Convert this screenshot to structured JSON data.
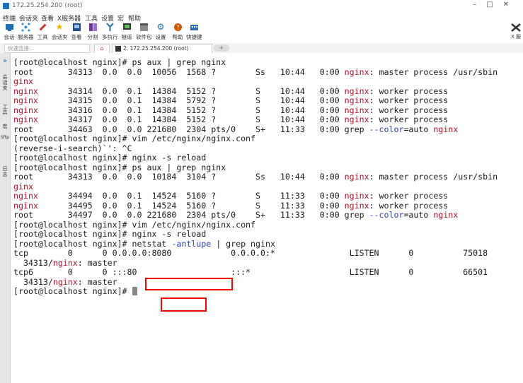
{
  "window": {
    "title": "172.25.254.200 (root)"
  },
  "menu": [
    "终端",
    "会话夹",
    "查看",
    "X服务器",
    "工具",
    "设置",
    "宏",
    "帮助"
  ],
  "toolbar": [
    {
      "label": "会话",
      "icon": "session-icon",
      "color": "#1e6fb8"
    },
    {
      "label": "服务器",
      "icon": "server-icon",
      "color": "#2a8be0"
    },
    {
      "label": "工具",
      "icon": "tools-icon",
      "color": "#c0392b"
    },
    {
      "label": "会话夹",
      "icon": "star-icon",
      "color": "#f5b400"
    },
    {
      "label": "查看",
      "icon": "view-icon",
      "color": "#1f4e8c"
    },
    {
      "label": "分割",
      "icon": "split-icon",
      "color": "#6a3aa0"
    },
    {
      "label": "多执行",
      "icon": "multi-exec-icon",
      "color": "#2a6fb8"
    },
    {
      "label": "隧道",
      "icon": "tunnel-icon",
      "color": "#333333"
    },
    {
      "label": "软件包",
      "icon": "package-icon",
      "color": "#555555"
    },
    {
      "label": "设置",
      "icon": "settings-icon",
      "color": "#1e6fb8"
    },
    {
      "label": "帮助",
      "icon": "help-icon",
      "color": "#d35400"
    },
    {
      "label": "快捷键",
      "icon": "keyboard-icon",
      "color": "#2a6fb8"
    }
  ],
  "xserver": {
    "label": "X 服"
  },
  "address": {
    "placeholder": "快速连接..."
  },
  "tabs": {
    "active": "2. 172.25.254.200 (root)"
  },
  "sidebar": [
    "会话夹",
    "工具",
    "宏",
    "Sftp",
    "日志"
  ],
  "terminal": {
    "lines": [
      [
        [
          "[root@localhost nginx]# ps aux | grep nginx",
          "n"
        ]
      ],
      [
        [
          "root       34313  0.0  0.0  10056  1568 ?        Ss   10:44   0:00 ",
          "n"
        ],
        [
          "nginx",
          "r"
        ],
        [
          ": master process /usr/sbin",
          "n"
        ]
      ],
      [
        [
          "ginx",
          "r"
        ]
      ],
      [
        [
          "nginx",
          "r"
        ],
        [
          "      34314  0.0  0.1  14384  5152 ?        S    10:44   0:00 ",
          "n"
        ],
        [
          "nginx",
          "r"
        ],
        [
          ": worker process",
          "n"
        ]
      ],
      [
        [
          "nginx",
          "r"
        ],
        [
          "      34315  0.0  0.1  14384  5792 ?        S    10:44   0:00 ",
          "n"
        ],
        [
          "nginx",
          "r"
        ],
        [
          ": worker process",
          "n"
        ]
      ],
      [
        [
          "nginx",
          "r"
        ],
        [
          "      34316  0.0  0.1  14384  5152 ?        S    10:44   0:00 ",
          "n"
        ],
        [
          "nginx",
          "r"
        ],
        [
          ": worker process",
          "n"
        ]
      ],
      [
        [
          "nginx",
          "r"
        ],
        [
          "      34317  0.0  0.1  14384  5152 ?        S    10:44   0:00 ",
          "n"
        ],
        [
          "nginx",
          "r"
        ],
        [
          ": worker process",
          "n"
        ]
      ],
      [
        [
          "root       34463  0.0  0.0 221680  2304 pts/0    S+   11:33   0:00 grep ",
          "n"
        ],
        [
          "--color",
          "b"
        ],
        [
          "=auto ",
          "n"
        ],
        [
          "nginx",
          "r"
        ]
      ],
      [
        [
          "[root@localhost nginx]# vim /etc/nginx/nginx.conf",
          "n"
        ]
      ],
      [
        [
          "(reverse-i-search)`': ^C",
          "n"
        ]
      ],
      [
        [
          "[root@localhost nginx]# nginx -s reload",
          "n"
        ]
      ],
      [
        [
          "[root@localhost nginx]# ps aux | grep nginx",
          "n"
        ]
      ],
      [
        [
          "root       34313  0.0  0.0  10184  3104 ?        Ss   10:44   0:00 ",
          "n"
        ],
        [
          "nginx",
          "r"
        ],
        [
          ": master process /usr/sbin",
          "n"
        ]
      ],
      [
        [
          "ginx",
          "r"
        ]
      ],
      [
        [
          "nginx",
          "r"
        ],
        [
          "      34494  0.0  0.1  14524  5160 ?        S    11:33   0:00 ",
          "n"
        ],
        [
          "nginx",
          "r"
        ],
        [
          ": worker process",
          "n"
        ]
      ],
      [
        [
          "nginx",
          "r"
        ],
        [
          "      34495  0.0  0.1  14524  5160 ?        S    11:33   0:00 ",
          "n"
        ],
        [
          "nginx",
          "r"
        ],
        [
          ": worker process",
          "n"
        ]
      ],
      [
        [
          "root       34497  0.0  0.0 221680  2304 pts/0    S+   11:33   0:00 grep ",
          "n"
        ],
        [
          "--color",
          "b"
        ],
        [
          "=auto ",
          "n"
        ],
        [
          "nginx",
          "r"
        ]
      ],
      [
        [
          "[root@localhost nginx]# vim /etc/nginx/nginx.conf",
          "n"
        ]
      ],
      [
        [
          "[root@localhost nginx]# nginx -s reload",
          "n"
        ]
      ],
      [
        [
          "[root@localhost nginx]# netstat ",
          "n"
        ],
        [
          "-antlupe",
          "b"
        ],
        [
          " | grep nginx",
          "n"
        ]
      ],
      [
        [
          "tcp        0      0 0.0.0.0:8080            0.0.0.0:*               LISTEN      0          75018",
          "n"
        ]
      ],
      [
        [
          "  34313/",
          "n"
        ],
        [
          "nginx",
          "r"
        ],
        [
          ": master",
          "n"
        ]
      ],
      [
        [
          "tcp6       0      0 :::80                   :::*                    LISTEN      0          66501",
          "n"
        ]
      ],
      [
        [
          "  34313/",
          "n"
        ],
        [
          "nginx",
          "r"
        ],
        [
          ": master",
          "n"
        ]
      ],
      [
        [
          "[root@localhost nginx]# ",
          "n"
        ]
      ]
    ]
  }
}
